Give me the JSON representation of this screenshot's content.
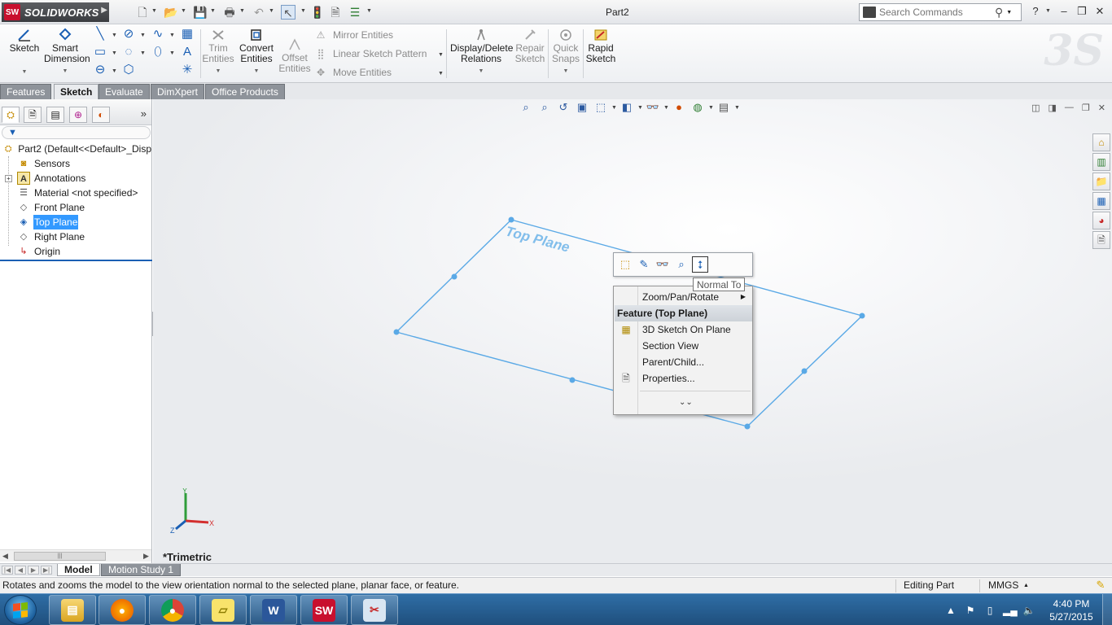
{
  "app": {
    "name": "SOLIDWORKS",
    "document_title": "Part2",
    "logo_badge": "SW"
  },
  "search": {
    "placeholder": "Search Commands"
  },
  "ribbon": {
    "sketch": "Sketch",
    "smart_dimension_1": "Smart",
    "smart_dimension_2": "Dimension",
    "trim_1": "Trim",
    "trim_2": "Entities",
    "convert_1": "Convert",
    "convert_2": "Entities",
    "offset_1": "Offset",
    "offset_2": "Entities",
    "mirror": "Mirror Entities",
    "linear_pattern": "Linear Sketch Pattern",
    "move": "Move Entities",
    "display_relations_1": "Display/Delete",
    "display_relations_2": "Relations",
    "repair_1": "Repair",
    "repair_2": "Sketch",
    "quick_snaps_1": "Quick",
    "quick_snaps_2": "Snaps",
    "rapid_1": "Rapid",
    "rapid_2": "Sketch"
  },
  "tabs": [
    {
      "label": "Features"
    },
    {
      "label": "Sketch"
    },
    {
      "label": "Evaluate"
    },
    {
      "label": "DimXpert"
    },
    {
      "label": "Office Products"
    }
  ],
  "tree": {
    "root": "Part2  (Default<<Default>_Disp",
    "items": [
      {
        "label": "Sensors",
        "icon": "sensor-icon"
      },
      {
        "label": "Annotations",
        "icon": "annotation-icon"
      },
      {
        "label": "Material <not specified>",
        "icon": "material-icon"
      },
      {
        "label": "Front Plane",
        "icon": "plane-icon"
      },
      {
        "label": "Top Plane",
        "icon": "plane-icon",
        "selected": true
      },
      {
        "label": "Right Plane",
        "icon": "plane-icon"
      },
      {
        "label": "Origin",
        "icon": "origin-icon"
      }
    ]
  },
  "graphics": {
    "plane_label": "Top Plane",
    "view_name": "*Trimetric",
    "plane_color": "#5aa9e6",
    "triad": {
      "x": "X",
      "y": "Y",
      "z": "Z"
    }
  },
  "context_toolbar": {
    "tooltip": "Normal To"
  },
  "context_menu": {
    "zoom_pan_rotate": "Zoom/Pan/Rotate",
    "header": "Feature (Top Plane)",
    "items": [
      {
        "label": "3D Sketch On Plane",
        "icon": "3d-sketch-icon"
      },
      {
        "label": "Section View",
        "icon": ""
      },
      {
        "label": "Parent/Child...",
        "icon": ""
      },
      {
        "label": "Properties...",
        "icon": "properties-icon"
      }
    ]
  },
  "model_tabs": [
    {
      "label": "Model"
    },
    {
      "label": "Motion Study 1"
    }
  ],
  "status": {
    "message": "Rotates and zooms the model to the view orientation normal to the selected plane, planar face, or feature.",
    "mode": "Editing Part",
    "units": "MMGS"
  },
  "clock": {
    "time": "4:40 PM",
    "date": "5/27/2015"
  },
  "colors": {
    "selection": "#3399ff",
    "accent": "#1a5fb4",
    "brand": "#c8102e"
  }
}
